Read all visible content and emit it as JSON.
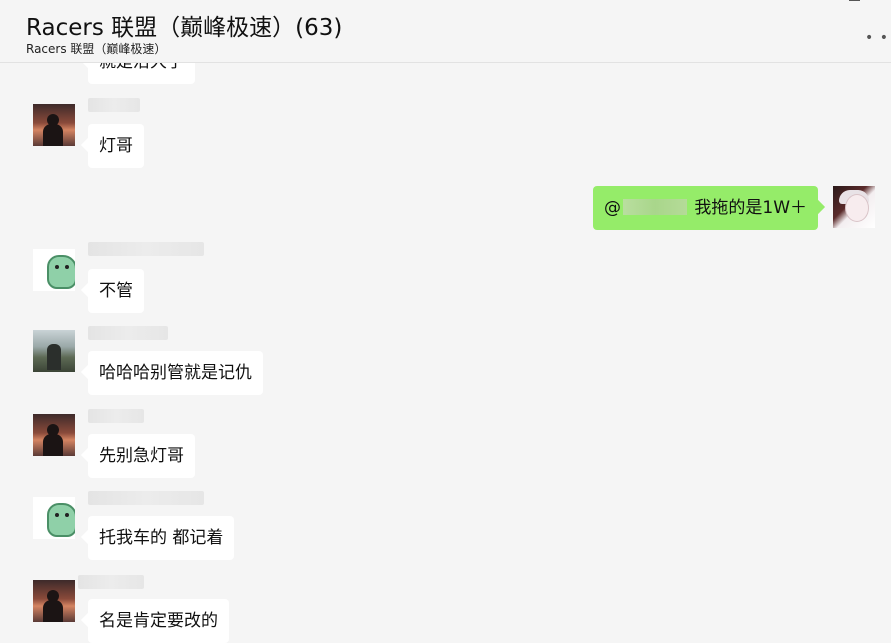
{
  "header": {
    "title": "Racers 联盟（巅峰极速）(63)",
    "subtitle": "Racers 联盟（巅峰极速）",
    "more_icon": "more-dots-icon"
  },
  "messages": [
    {
      "sender": "other",
      "avatar": "sunset-silhouette",
      "text": "就是沿大了"
    },
    {
      "sender": "other",
      "avatar": "sunset-silhouette",
      "text": "灯哥"
    },
    {
      "sender": "me",
      "avatar": "anime-girl",
      "prefix": "@",
      "text": " 我拖的是1W＋"
    },
    {
      "sender": "other",
      "avatar": "green-dino",
      "text": "不管"
    },
    {
      "sender": "other",
      "avatar": "mountain-person",
      "text": "哈哈哈别管就是记仇"
    },
    {
      "sender": "other",
      "avatar": "sunset-silhouette",
      "text": "先别急灯哥"
    },
    {
      "sender": "other",
      "avatar": "green-dino",
      "text": "托我车的 都记着"
    },
    {
      "sender": "other",
      "avatar": "sunset-silhouette",
      "text": "名是肯定要改的"
    }
  ]
}
